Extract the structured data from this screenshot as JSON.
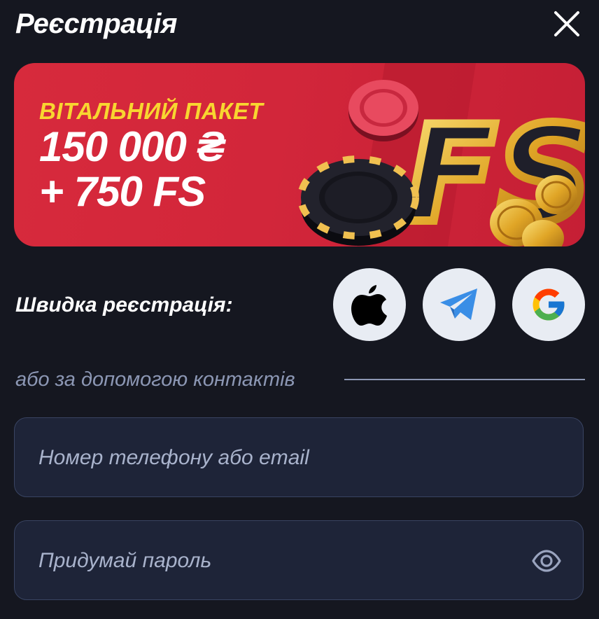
{
  "header": {
    "title": "Реєстрація",
    "close_icon": "close-icon"
  },
  "banner": {
    "line1": "ВІТАЛЬНИЙ ПАКЕТ",
    "line2": "150 000 ₴",
    "line3": "+ 750 FS",
    "art_text": "FS",
    "colors": {
      "background": "#d72a3c",
      "headline": "#f8d630",
      "chips": "#1b1b22",
      "gold": "#e0a526"
    }
  },
  "quick_registration": {
    "label": "Швидка реєстрація:",
    "buttons": [
      {
        "name": "apple",
        "icon": "apple-icon"
      },
      {
        "name": "telegram",
        "icon": "telegram-icon"
      },
      {
        "name": "google",
        "icon": "google-icon"
      }
    ]
  },
  "divider": {
    "text": "або за допомогою контактів"
  },
  "form": {
    "contact_placeholder": "Номер телефону або email",
    "contact_value": "",
    "password_placeholder": "Придумай пароль",
    "password_value": "",
    "eye_icon": "eye-icon"
  }
}
